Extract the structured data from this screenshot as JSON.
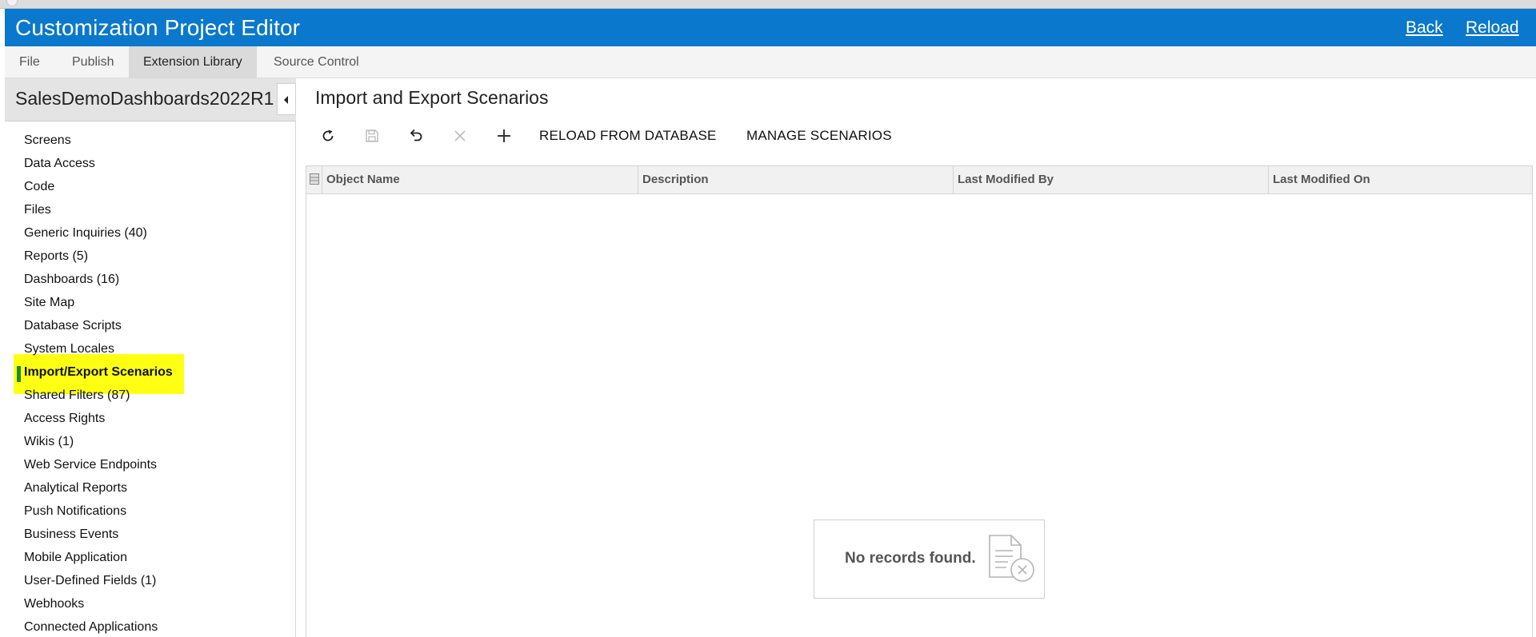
{
  "header": {
    "title": "Customization Project Editor",
    "back": "Back",
    "reload": "Reload",
    "color": "#0a78cc"
  },
  "menu": {
    "items": [
      {
        "label": "File",
        "active": false
      },
      {
        "label": "Publish",
        "active": false
      },
      {
        "label": "Extension Library",
        "active": true
      },
      {
        "label": "Source Control",
        "active": false
      }
    ]
  },
  "sidebar": {
    "project_name": "SalesDemoDashboards2022R1",
    "items": [
      {
        "label": "Screens"
      },
      {
        "label": "Data Access"
      },
      {
        "label": "Code"
      },
      {
        "label": "Files"
      },
      {
        "label": "Generic Inquiries (40)"
      },
      {
        "label": "Reports (5)"
      },
      {
        "label": "Dashboards (16)"
      },
      {
        "label": "Site Map"
      },
      {
        "label": "Database Scripts"
      },
      {
        "label": "System Locales"
      },
      {
        "label": "Import/Export Scenarios",
        "selected": true
      },
      {
        "label": "Shared Filters (87)"
      },
      {
        "label": "Access Rights"
      },
      {
        "label": "Wikis (1)"
      },
      {
        "label": "Web Service Endpoints"
      },
      {
        "label": "Analytical Reports"
      },
      {
        "label": "Push Notifications"
      },
      {
        "label": "Business Events"
      },
      {
        "label": "Mobile Application"
      },
      {
        "label": "User-Defined Fields (1)"
      },
      {
        "label": "Webhooks"
      },
      {
        "label": "Connected Applications"
      }
    ],
    "highlight_color": "#ffff14",
    "selected_marker_color": "#1e8a2e"
  },
  "main": {
    "title": "Import and Export Scenarios",
    "toolbar": {
      "icons": [
        "refresh-icon",
        "save-icon",
        "undo-icon",
        "delete-icon",
        "add-icon"
      ],
      "reload_from_database": "RELOAD FROM DATABASE",
      "manage_scenarios": "MANAGE SCENARIOS"
    },
    "grid": {
      "columns": [
        "Object Name",
        "Description",
        "Last Modified By",
        "Last Modified On"
      ],
      "rows": [],
      "empty_message": "No records found."
    }
  }
}
